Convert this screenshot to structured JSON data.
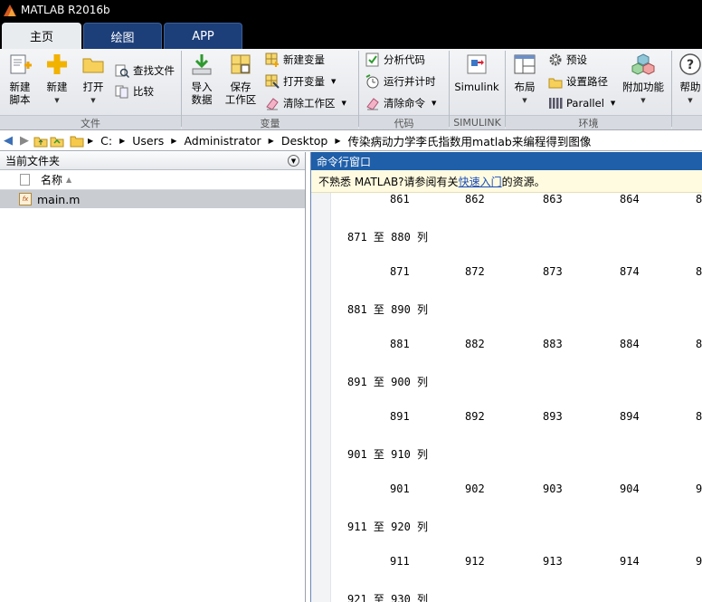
{
  "window": {
    "title": "MATLAB R2016b"
  },
  "tabs": [
    {
      "label": "主页",
      "active": true
    },
    {
      "label": "绘图",
      "active": false
    },
    {
      "label": "APP",
      "active": false
    }
  ],
  "ribbon": {
    "file_group": {
      "label": "文件",
      "new_script": "新建\n脚本",
      "new_script_l1": "新建",
      "new_script_l2": "脚本",
      "new": "新建",
      "open": "打开",
      "find_files": "查找文件",
      "compare": "比较"
    },
    "variable_group": {
      "label": "变量",
      "import_l1": "导入",
      "import_l2": "数据",
      "save_l1": "保存",
      "save_l2": "工作区",
      "new_variable": "新建变量",
      "open_variable": "打开变量",
      "clear_workspace": "清除工作区"
    },
    "code_group": {
      "label": "代码",
      "analyze_code": "分析代码",
      "run_and_time": "运行并计时",
      "clear_commands": "清除命令"
    },
    "simulink_group": {
      "label": "SIMULINK",
      "simulink": "Simulink"
    },
    "environment_group": {
      "label": "环境",
      "layout": "布局",
      "preferences": "预设",
      "set_path": "设置路径",
      "parallel": "Parallel",
      "add_ons": "附加功能",
      "help": "帮助"
    }
  },
  "address": {
    "path": [
      "C:",
      "Users",
      "Administrator",
      "Desktop",
      "传染病动力学李氏指数用matlab来编程得到图像"
    ]
  },
  "current_folder": {
    "title": "当前文件夹",
    "column_name": "名称",
    "files": [
      "main.m"
    ]
  },
  "command_window": {
    "title": "命令行窗口",
    "notice_prefix": "不熟悉 MATLAB?请参阅有关",
    "notice_link": "快速入门",
    "notice_suffix": "的资源。",
    "output": [
      {
        "type": "nums",
        "values": [
          "861",
          "862",
          "863",
          "864",
          "8"
        ]
      },
      {
        "type": "header",
        "text": "871 至 880 列"
      },
      {
        "type": "nums",
        "values": [
          "871",
          "872",
          "873",
          "874",
          "8"
        ]
      },
      {
        "type": "header",
        "text": "881 至 890 列"
      },
      {
        "type": "nums",
        "values": [
          "881",
          "882",
          "883",
          "884",
          "8"
        ]
      },
      {
        "type": "header",
        "text": "891 至 900 列"
      },
      {
        "type": "nums",
        "values": [
          "891",
          "892",
          "893",
          "894",
          "8"
        ]
      },
      {
        "type": "header",
        "text": "901 至 910 列"
      },
      {
        "type": "nums",
        "values": [
          "901",
          "902",
          "903",
          "904",
          "9"
        ]
      },
      {
        "type": "header",
        "text": "911 至 920 列"
      },
      {
        "type": "nums",
        "values": [
          "911",
          "912",
          "913",
          "914",
          "9"
        ]
      },
      {
        "type": "header",
        "text": "921 至 930 列"
      }
    ]
  },
  "colors": {
    "titlebar": "#000000",
    "active_tab": "#e9ecef",
    "inactive_tab": "#1c3f7a",
    "cmd_header": "#1f5ea8",
    "notice_bg": "#fffbe0",
    "link": "#1a4cb8"
  }
}
